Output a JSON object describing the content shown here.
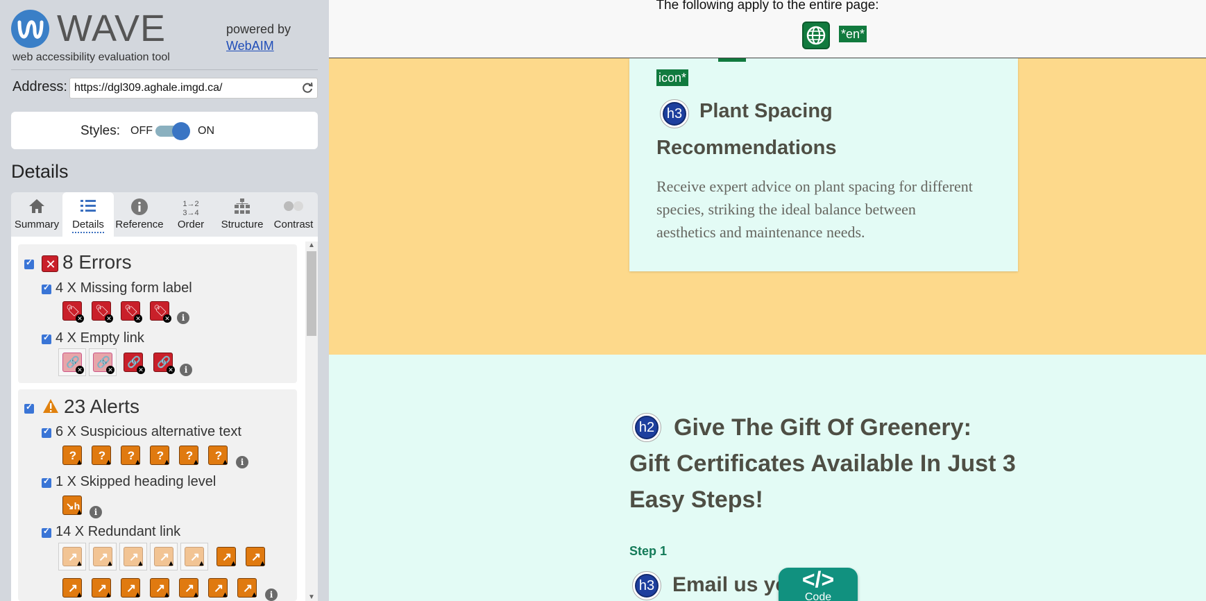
{
  "wave": {
    "brand": "WAVE",
    "subtitle": "web accessibility evaluation tool",
    "powered_by": "powered by",
    "webaim_link": "WebAIM"
  },
  "address": {
    "label": "Address:",
    "value": "https://dgl309.aghale.imgd.ca/"
  },
  "styles": {
    "label": "Styles:",
    "off": "OFF",
    "on": "ON",
    "state": "on"
  },
  "details_heading": "Details",
  "tabs": [
    {
      "label": "Summary",
      "icon": "home-icon"
    },
    {
      "label": "Details",
      "icon": "list-icon",
      "active": true
    },
    {
      "label": "Reference",
      "icon": "info-icon"
    },
    {
      "label": "Order",
      "icon": "order-icon"
    },
    {
      "label": "Structure",
      "icon": "structure-icon"
    },
    {
      "label": "Contrast",
      "icon": "contrast-icon"
    }
  ],
  "errors": {
    "title": "8 Errors",
    "items": [
      {
        "label": "4 X Missing form label"
      },
      {
        "label": "4 X Empty link"
      }
    ]
  },
  "alerts": {
    "title": "23 Alerts",
    "items": [
      {
        "label": "6 X Suspicious alternative text"
      },
      {
        "label": "1 X Skipped heading level"
      },
      {
        "label": "14 X Redundant link"
      }
    ]
  },
  "page": {
    "top_notice": "The following apply to the entire page:",
    "lang_badge": "*en*",
    "icon_badge": "icon*",
    "card_heading_level": "h3",
    "card_title": "Plant Spacing Recommendations",
    "card_desc": "Receive expert advice on plant spacing for different species, striking the ideal balance between aesthetics and maintenance needs.",
    "gift_heading_level": "h2",
    "gift_title": "Give The Gift Of Greenery: Gift Certificates Available In Just 3 Easy Steps!",
    "step_label": "Step 1",
    "email_heading_level": "h3",
    "email_title": "Email us you",
    "code_label": "Code",
    "code_symbol": "</>"
  },
  "colors": {
    "wave_blue": "#3a7fc7",
    "error_red": "#c9202a",
    "alert_orange": "#e07a10",
    "wave_green": "#117a3e",
    "yellow_bg": "#fdd98b",
    "mint_bg": "#e3fbf5",
    "code_teal": "#11917f"
  }
}
